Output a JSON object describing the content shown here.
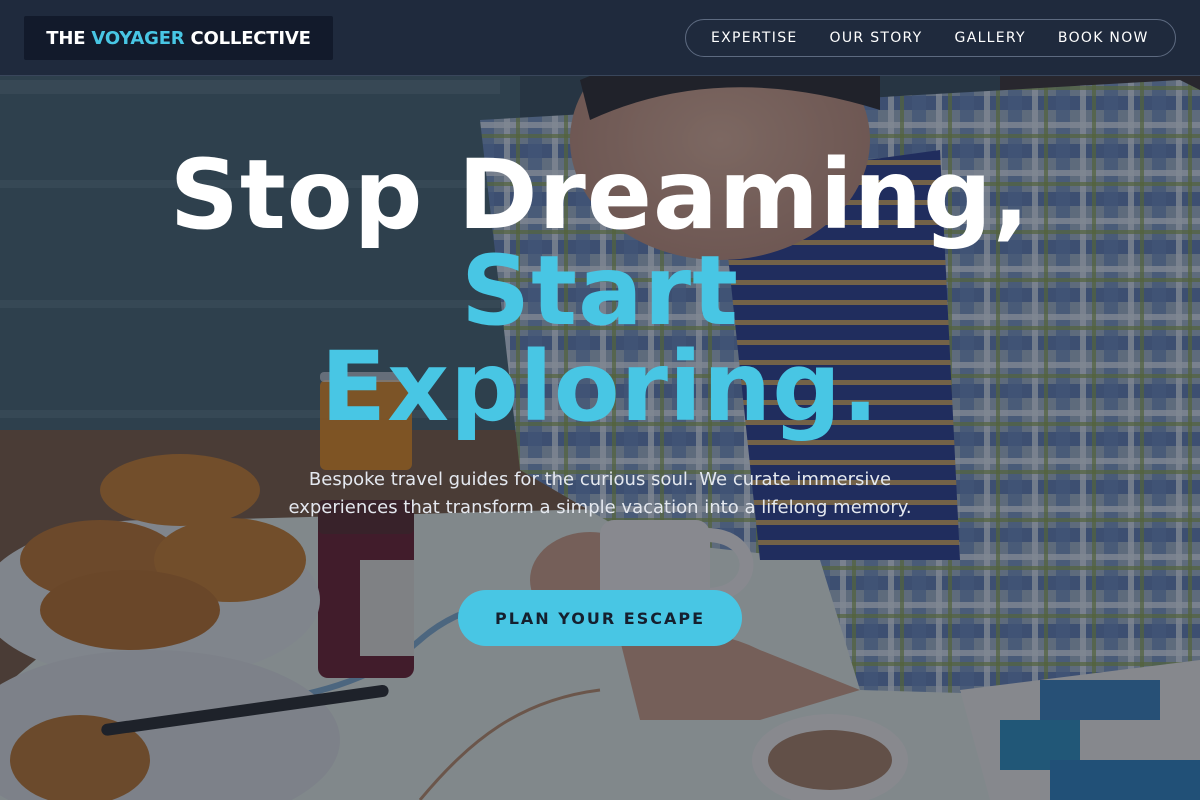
{
  "brand": {
    "logo_part1": "THE",
    "logo_accent": "VOYAGER",
    "logo_part2": "COLLECTIVE"
  },
  "nav": {
    "items": [
      {
        "label": "EXPERTISE"
      },
      {
        "label": "OUR STORY"
      },
      {
        "label": "GALLERY"
      },
      {
        "label": "BOOK NOW"
      }
    ]
  },
  "hero": {
    "headline_line1": "Stop Dreaming,",
    "headline_line2": "Start",
    "headline_line3": "Exploring.",
    "subtitle": "Bespoke travel guides for the curious soul. We curate immersive experiences that transform a simple vacation into a lifelong memory.",
    "cta_label": "PLAN YOUR ESCAPE"
  },
  "colors": {
    "accent": "#48c6e4",
    "navbar_bg": "#1f2a3d",
    "logo_bg": "#121a2b",
    "cta_text": "#15202f"
  }
}
